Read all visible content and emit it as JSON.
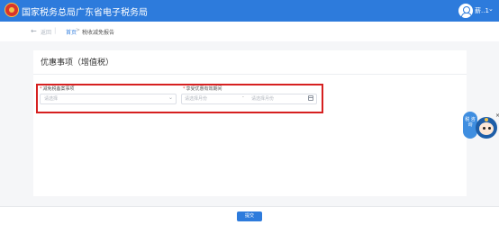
{
  "header": {
    "app_title": "国家税务总局广东省电子税务局",
    "user_name": "薪..1",
    "user_menu_icon": "chevron-down-icon",
    "colors": {
      "bar": "#2d7bdc"
    }
  },
  "breadcrumb": {
    "back_label": "返回",
    "home": "首页",
    "separator": ">",
    "current": "税收减免报告"
  },
  "card": {
    "title": "优惠事项（增值税）"
  },
  "form": {
    "field1": {
      "required": "*",
      "label": "减免税备案事项",
      "placeholder": "请选择"
    },
    "field2": {
      "required": "*",
      "label": "享受优惠有效期间",
      "start_placeholder": "请选择月份",
      "separator": "-",
      "end_placeholder": "请选择月份"
    },
    "highlight_color": "#d62020"
  },
  "assistant": {
    "bubble_text": "税 咨 询",
    "close_glyph": "×"
  },
  "footer": {
    "submit_label": "提交"
  }
}
